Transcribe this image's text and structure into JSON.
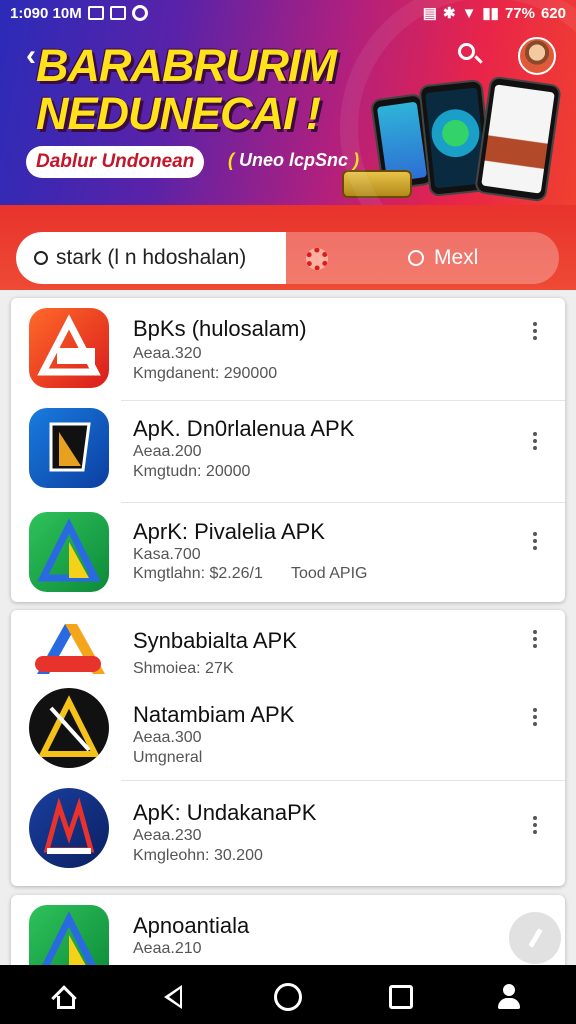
{
  "status_bar": {
    "time": "1:090 10M",
    "battery": "77%",
    "right_extra": "620"
  },
  "header": {
    "title_line1": "BARABRURIM",
    "title_line2": "NEDUNECAI !",
    "pill_text": "Dablur Undonean",
    "sub_text": "Uneo lcpSnc"
  },
  "search": {
    "value": "stark (l n hdoshalan)",
    "next_label": "Mexl"
  },
  "apps": [
    {
      "name": "BpKs (hulosalam)",
      "meta1": "Aeaa.320",
      "meta2": "Kmgdanent: 290000"
    },
    {
      "name": "ApK. Dn0rlalenua APK",
      "meta1": "Aeaa.200",
      "meta2": "Kmgtudn: 20000"
    },
    {
      "name": "AprK: Pivalelia APK",
      "meta1": "Kasa.700",
      "meta2": "Kmgtlahn: $2.26/1",
      "meta3": "Tood APIG"
    },
    {
      "name": "Synbabialta APK",
      "meta1": "Shmoiea: 27K"
    },
    {
      "name": "Natambiam APK",
      "meta1": "Aeaa.300",
      "meta2": "Umgneral"
    },
    {
      "name": "ApK: UndakanaPK",
      "meta1": "Aeaa.230",
      "meta2": "Kmgleohn: 30.200"
    },
    {
      "name": "Apnoantiala",
      "meta1": "Aeaa.210",
      "meta2": ""
    }
  ],
  "icons": {
    "back": "arrow-left-icon",
    "search": "search-icon",
    "settings": "gear-icon",
    "menu": "more-vert-icon",
    "nav": [
      "home-icon",
      "back-triangle-icon",
      "circle-home-icon",
      "square-recents-icon",
      "person-icon"
    ]
  },
  "colors": {
    "banner_start": "#2b2bb8",
    "banner_end": "#f0402f",
    "title_yellow": "#ffe21a",
    "search_red": "#e8332c"
  }
}
